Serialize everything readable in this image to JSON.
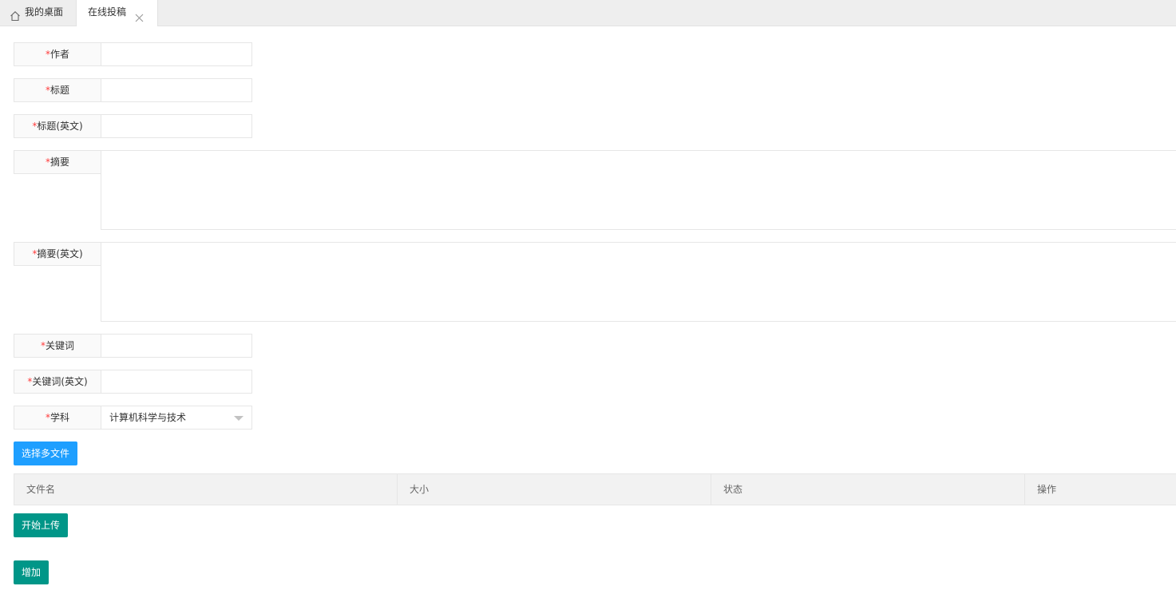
{
  "tabs": {
    "home": {
      "label": "我的桌面",
      "icon": "home-icon"
    },
    "active": {
      "label": "在线投稿",
      "close_icon": "close-icon"
    }
  },
  "form": {
    "required_mark": "*",
    "author": {
      "label": "作者",
      "value": ""
    },
    "title": {
      "label": "标题",
      "value": ""
    },
    "title_en": {
      "label": "标题(英文)",
      "value": ""
    },
    "abstract": {
      "label": "摘要",
      "value": ""
    },
    "abstract_en": {
      "label": "摘要(英文)",
      "value": ""
    },
    "keywords": {
      "label": "关键词",
      "value": ""
    },
    "keywords_en": {
      "label": "关键词(英文)",
      "value": ""
    },
    "subject": {
      "label": "学科",
      "selected": "计算机科学与技术"
    }
  },
  "buttons": {
    "select_files": "选择多文件",
    "start_upload": "开始上传",
    "add": "增加"
  },
  "file_table": {
    "headers": [
      "文件名",
      "大小",
      "状态",
      "操作"
    ]
  },
  "colors": {
    "accent_blue": "#1E9FFF",
    "accent_green": "#009688",
    "required": "#ff3b3b"
  }
}
